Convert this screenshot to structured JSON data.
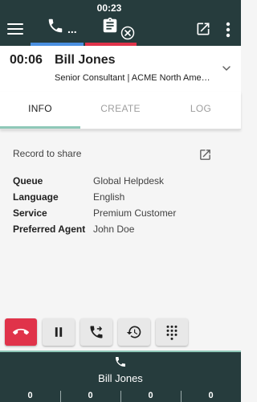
{
  "topbar": {
    "timer": "00:23",
    "call_tab_dots": "...",
    "icons": [
      "menu-icon",
      "phone-icon",
      "clipboard-icon",
      "close-circle-icon",
      "popout-icon",
      "more-vert-icon"
    ],
    "colors": {
      "bar": "#263c3d",
      "call_tab": "#4a8fe0",
      "task_tab": "#e0334a"
    }
  },
  "call_header": {
    "duration": "00:06",
    "name": "Bill Jones",
    "subtitle": "Senior Consultant | ACME North America"
  },
  "tabs": [
    {
      "label": "INFO",
      "active": true
    },
    {
      "label": "CREATE",
      "active": false
    },
    {
      "label": "LOG",
      "active": false
    }
  ],
  "info": {
    "record_label": "Record to share",
    "fields": [
      {
        "label": "Queue",
        "value": "Global Helpdesk"
      },
      {
        "label": "Language",
        "value": "English"
      },
      {
        "label": "Service",
        "value": "Premium Customer"
      },
      {
        "label": "Preferred Agent",
        "value": "John Doe"
      }
    ]
  },
  "controls": [
    "hangup-icon",
    "pause-icon",
    "transfer-icon",
    "history-icon",
    "dialpad-icon"
  ],
  "bottom": {
    "name": "Bill Jones",
    "stats": [
      "0",
      "0",
      "0",
      "0"
    ]
  }
}
